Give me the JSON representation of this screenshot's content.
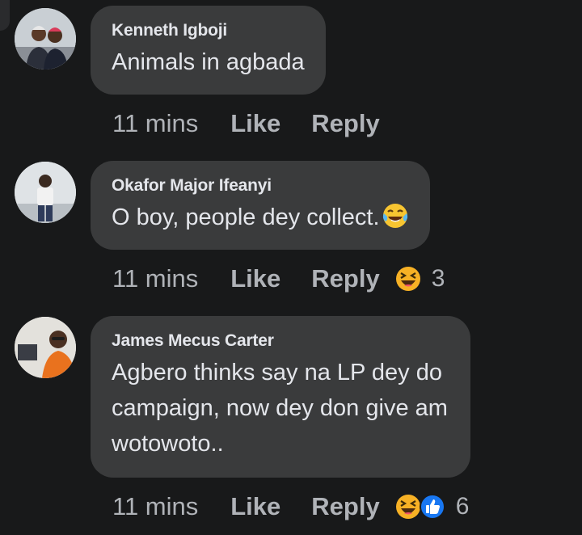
{
  "comments": [
    {
      "author": "Kenneth Igboji",
      "text": "Animals in agbada",
      "time": "11 mins",
      "like_label": "Like",
      "reply_label": "Reply"
    },
    {
      "author": "Okafor Major Ifeanyi",
      "text": "O boy, people dey collect.",
      "inline_emoji": "tears-of-joy-emoji",
      "time": "11 mins",
      "like_label": "Like",
      "reply_label": "Reply",
      "reactions": [
        "haha"
      ],
      "reaction_count": "3"
    },
    {
      "author": "James Mecus Carter",
      "text_lines": [
        "Agbero thinks say na LP dey do",
        "campaign, now dey don give am",
        "wotowoto.."
      ],
      "time": "11 mins",
      "like_label": "Like",
      "reply_label": "Reply",
      "reactions": [
        "haha",
        "like"
      ],
      "reaction_count": "6"
    }
  ],
  "colors": {
    "background": "#18191a",
    "bubble": "#3a3b3c",
    "text": "#e4e6eb",
    "secondary_text": "#b0b3b8",
    "like_reaction": "#1877f2",
    "haha_reaction": "#f7b125"
  }
}
